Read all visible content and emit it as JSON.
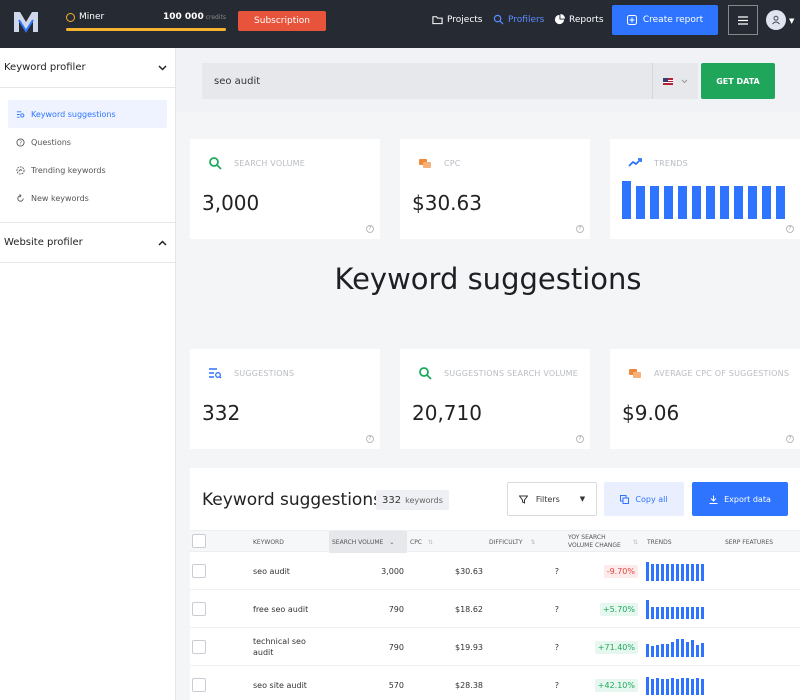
{
  "topbar": {
    "plan_name": "Miner",
    "credits": "100 000",
    "credits_unit": "credits",
    "subscription_label": "Subscription",
    "nav": [
      {
        "label": "Projects",
        "icon": "folder-icon"
      },
      {
        "label": "Profilers",
        "icon": "search-icon",
        "active": true
      },
      {
        "label": "Reports",
        "icon": "pie-chart-icon"
      }
    ],
    "create_report_label": "Create report"
  },
  "sidebar": {
    "keyword_profiler": {
      "title": "Keyword profiler",
      "items": [
        {
          "label": "Keyword suggestions",
          "icon": "suggestions-icon",
          "active": true
        },
        {
          "label": "Questions",
          "icon": "question-icon"
        },
        {
          "label": "Trending keywords",
          "icon": "trending-icon"
        },
        {
          "label": "New keywords",
          "icon": "refresh-icon"
        }
      ]
    },
    "website_profiler": {
      "title": "Website profiler"
    }
  },
  "search": {
    "value": "seo audit",
    "location": "US",
    "button_label": "GET DATA"
  },
  "stats_top": [
    {
      "label": "SEARCH VOLUME",
      "value": "3,000",
      "icon": "search-icon",
      "icon_color": "#1eaa5e"
    },
    {
      "label": "CPC",
      "value": "$30.63",
      "icon": "coins-icon",
      "icon_color": "#f0883a"
    },
    {
      "label": "TRENDS",
      "icon": "trend-up-icon",
      "icon_color": "#2f74ff",
      "trend": [
        100,
        88,
        88,
        88,
        88,
        88,
        88,
        88,
        88,
        88,
        88,
        88
      ]
    }
  ],
  "page_title": "Keyword suggestions",
  "stats_bottom": [
    {
      "label": "SUGGESTIONS",
      "value": "332",
      "icon": "list-search-icon",
      "icon_color": "#2f74ff"
    },
    {
      "label": "SUGGESTIONS SEARCH VOLUME",
      "value": "20,710",
      "icon": "search-icon",
      "icon_color": "#1eaa5e"
    },
    {
      "label": "AVERAGE CPC OF SUGGESTIONS",
      "value": "$9.06",
      "icon": "coins-icon",
      "icon_color": "#f0883a"
    }
  ],
  "table_panel": {
    "title": "Keyword suggestions",
    "count": "332",
    "count_unit": "keywords",
    "filters_label": "Filters",
    "copy_label": "Copy all",
    "export_label": "Export data",
    "columns": {
      "keyword": "KEYWORD",
      "search_volume": "SEARCH VOLUME",
      "cpc": "CPC",
      "difficulty": "DIFFICULTY",
      "yoy_line1": "YOY SEARCH",
      "yoy_line2": "VOLUME CHANGE",
      "trends": "TRENDS",
      "serp": "SERP FEATURES"
    },
    "rows": [
      {
        "keyword": "seo audit",
        "volume": "3,000",
        "cpc": "$30.63",
        "difficulty": "?",
        "change": "-9.70%",
        "dir": "neg",
        "trend": [
          95,
          85,
          85,
          85,
          85,
          85,
          85,
          85,
          85,
          85,
          85,
          85
        ]
      },
      {
        "keyword": "free seo audit",
        "volume": "790",
        "cpc": "$18.62",
        "difficulty": "?",
        "change": "+5.70%",
        "dir": "pos",
        "trend": [
          95,
          60,
          60,
          60,
          60,
          60,
          60,
          60,
          60,
          60,
          60,
          60
        ]
      },
      {
        "keyword": "technical seo audit",
        "volume": "790",
        "cpc": "$19.93",
        "difficulty": "?",
        "change": "+71.40%",
        "dir": "pos",
        "trend": [
          65,
          55,
          60,
          65,
          65,
          75,
          90,
          90,
          75,
          85,
          60,
          70
        ]
      },
      {
        "keyword": "seo site audit",
        "volume": "570",
        "cpc": "$28.38",
        "difficulty": "?",
        "change": "+42.10%",
        "dir": "pos",
        "trend": [
          90,
          80,
          85,
          80,
          80,
          85,
          80,
          85,
          85,
          80,
          85,
          80
        ]
      }
    ]
  }
}
